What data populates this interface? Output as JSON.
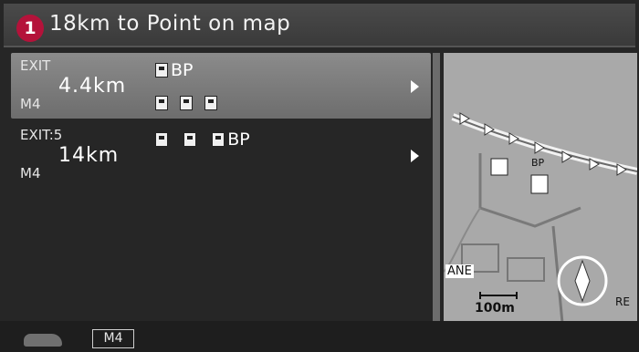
{
  "header": {
    "badge": "1",
    "title": "18km to Point on map"
  },
  "exits": [
    {
      "exit_label": "EXIT",
      "distance": "4.4km",
      "road": "M4",
      "brand": "BP",
      "icons": [
        "fuel-icon",
        "restaurant-icon",
        "picnic-icon",
        "rest-stop-icon"
      ],
      "selected": true
    },
    {
      "exit_label": "EXIT:5",
      "distance": "14km",
      "road": "M4",
      "brand": "BP",
      "icons": [
        "fuel-icon",
        "fuel-icon",
        "fuel-icon"
      ],
      "selected": false
    }
  ],
  "map": {
    "label_road": "ANE",
    "label_edge": "RE",
    "label_poi": "BP",
    "scale": "100m"
  },
  "footer": {
    "road": "M4"
  },
  "colors": {
    "badge": "#b4123a",
    "selected_row": "#7c7c7c",
    "background": "#262626",
    "map": "#a8a8a8"
  }
}
